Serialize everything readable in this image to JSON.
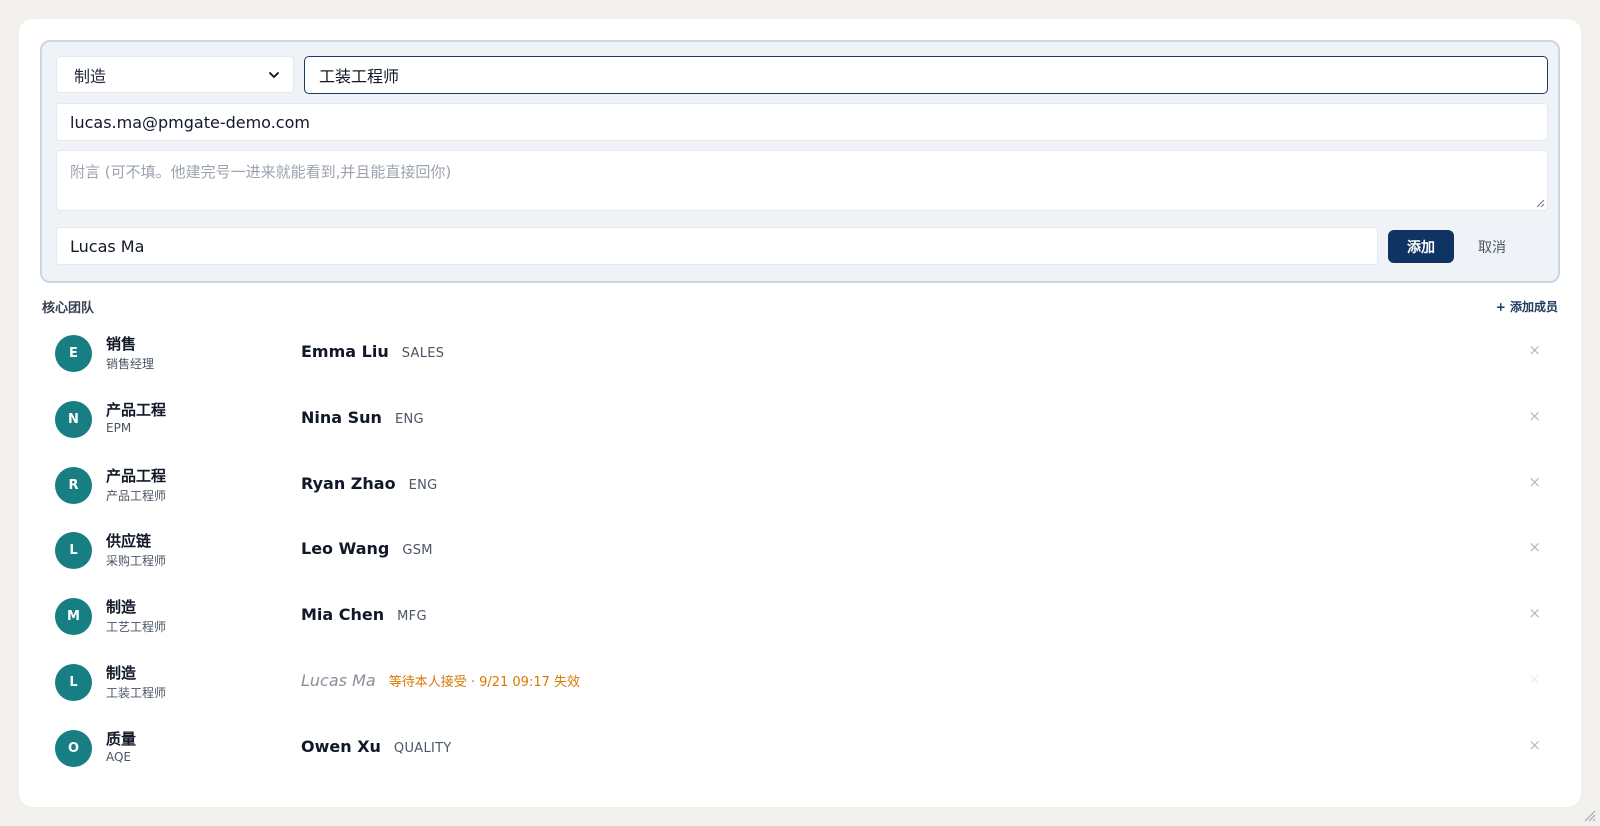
{
  "form": {
    "department_select": "制造",
    "role_value": "工装工程师",
    "email_value": "lucas.ma@pmgate-demo.com",
    "note_placeholder": "附言 (可不填。他建完号一进来就能看到,并且能直接回你)",
    "name_value": "Lucas Ma",
    "add_label": "添加",
    "cancel_label": "取消"
  },
  "team": {
    "title": "核心团队",
    "add_member_label": "+ 添加成员",
    "members": [
      {
        "initial": "E",
        "dept": "销售",
        "role": "销售经理",
        "name": "Emma Liu",
        "tag": "SALES",
        "pending": false
      },
      {
        "initial": "N",
        "dept": "产品工程",
        "role": "EPM",
        "name": "Nina Sun",
        "tag": "ENG",
        "pending": false
      },
      {
        "initial": "R",
        "dept": "产品工程",
        "role": "产品工程师",
        "name": "Ryan Zhao",
        "tag": "ENG",
        "pending": false
      },
      {
        "initial": "L",
        "dept": "供应链",
        "role": "采购工程师",
        "name": "Leo Wang",
        "tag": "GSM",
        "pending": false
      },
      {
        "initial": "M",
        "dept": "制造",
        "role": "工艺工程师",
        "name": "Mia Chen",
        "tag": "MFG",
        "pending": false
      },
      {
        "initial": "L",
        "dept": "制造",
        "role": "工装工程师",
        "name": "Lucas Ma",
        "tag": "等待本人接受 · 9/21 09:17 失效",
        "pending": true
      },
      {
        "initial": "O",
        "dept": "质量",
        "role": "AQE",
        "name": "Owen Xu",
        "tag": "QUALITY",
        "pending": false
      }
    ],
    "remove_glyph": "×"
  },
  "colors": {
    "accent": "#0f3464",
    "avatar": "#177e84",
    "pending": "#d97706"
  }
}
